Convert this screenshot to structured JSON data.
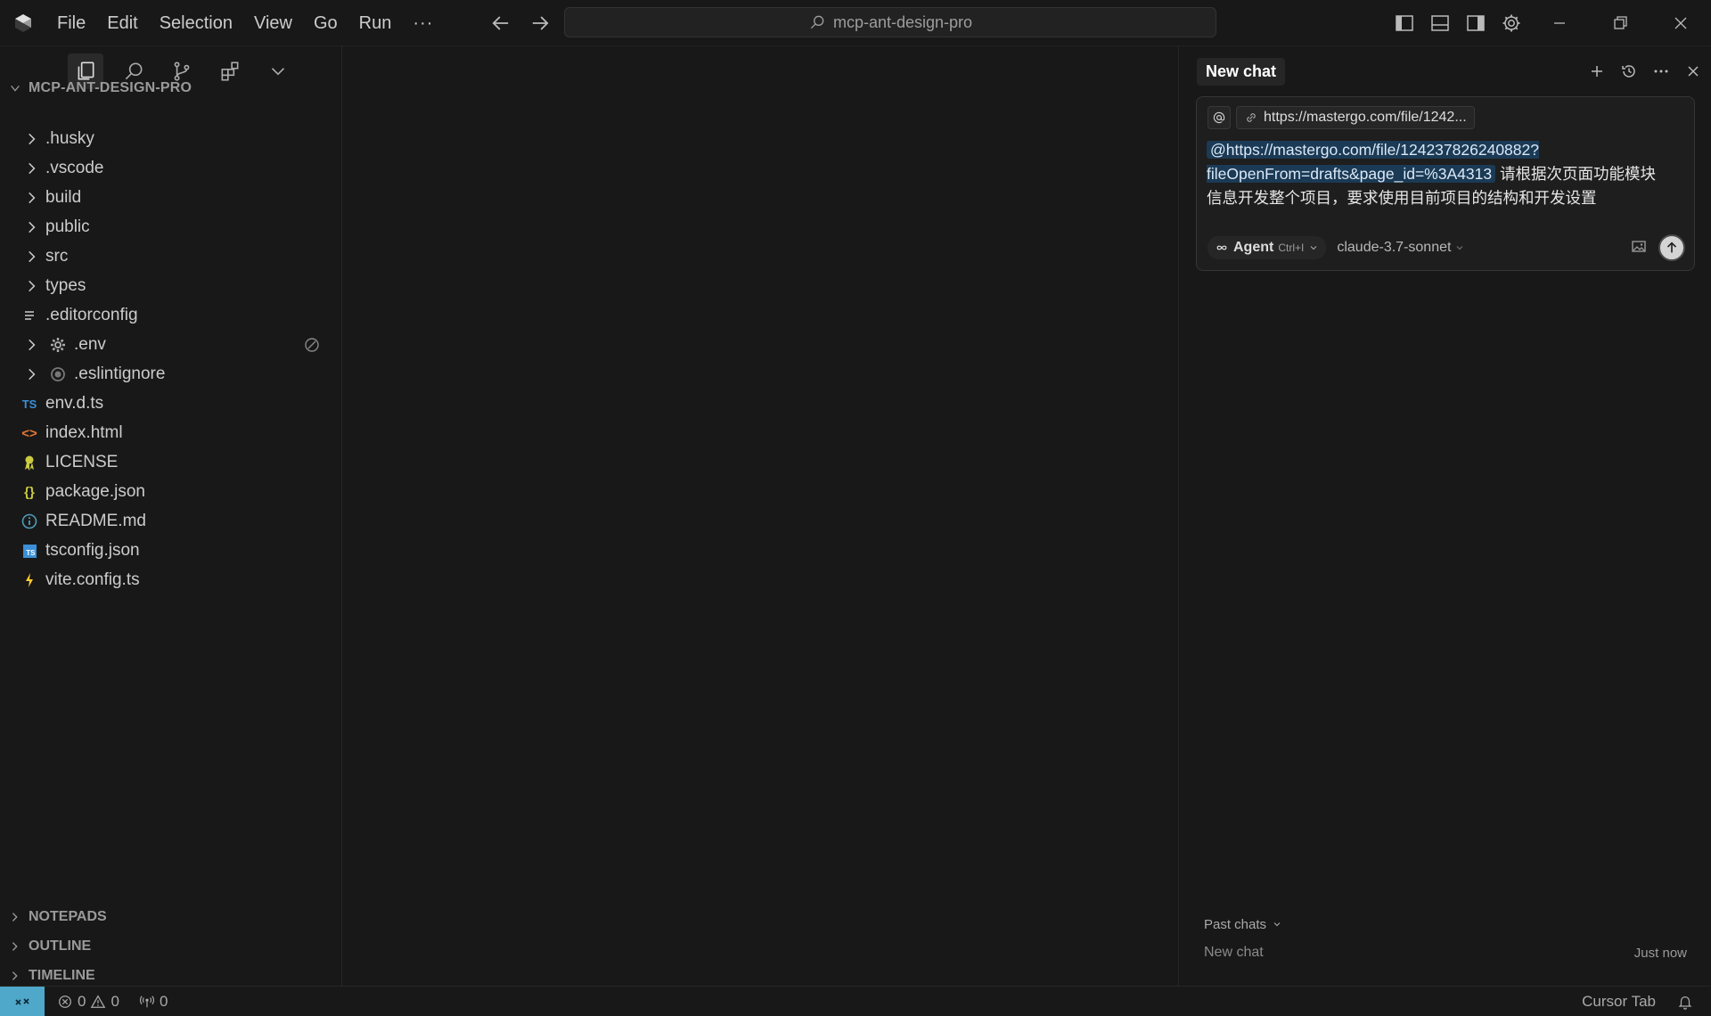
{
  "titlebar": {
    "menu": [
      "File",
      "Edit",
      "Selection",
      "View",
      "Go",
      "Run"
    ],
    "more": "···",
    "search_text": "mcp-ant-design-pro"
  },
  "sidebar": {
    "root_label": "MCP-ANT-DESIGN-PRO",
    "items": [
      {
        "label": ".husky",
        "kind": "folder"
      },
      {
        "label": ".vscode",
        "kind": "folder"
      },
      {
        "label": "build",
        "kind": "folder"
      },
      {
        "label": "public",
        "kind": "folder"
      },
      {
        "label": "src",
        "kind": "folder"
      },
      {
        "label": "types",
        "kind": "folder"
      },
      {
        "label": ".editorconfig",
        "kind": "file",
        "icon": "lines-icon"
      },
      {
        "label": ".env",
        "kind": "nested",
        "icon": "gear-icon"
      },
      {
        "label": ".eslintignore",
        "kind": "nested",
        "icon": "circle-icon"
      },
      {
        "label": "env.d.ts",
        "kind": "file",
        "icon": "ts-icon",
        "icon_text": "TS"
      },
      {
        "label": "index.html",
        "kind": "file",
        "icon": "html-icon",
        "icon_text": "<>"
      },
      {
        "label": "LICENSE",
        "kind": "file",
        "icon": "license-icon"
      },
      {
        "label": "package.json",
        "kind": "file",
        "icon": "json-icon",
        "icon_text": "{}"
      },
      {
        "label": "README.md",
        "kind": "file",
        "icon": "info-icon"
      },
      {
        "label": "tsconfig.json",
        "kind": "file",
        "icon": "tsconfig-icon",
        "icon_text": "TS"
      },
      {
        "label": "vite.config.ts",
        "kind": "file",
        "icon": "vite-icon"
      }
    ],
    "bottom_sections": [
      "NOTEPADS",
      "OUTLINE",
      "TIMELINE"
    ]
  },
  "chat": {
    "tab_label": "New chat",
    "context_pill": "https://mastergo.com/file/1242...",
    "prompt_mention_line1": "@https://mastergo.com/file/124237826240882?",
    "prompt_mention_line2": "fileOpenFrom=drafts&page_id=%3A4313",
    "prompt_text_line1": "请根据次页面功能模块",
    "prompt_text_line2": "信息开发整个项目，要求使用目前项目的结构和开发设置",
    "agent_label": "Agent",
    "agent_shortcut": "Ctrl+I",
    "model": "claude-3.7-sonnet",
    "past_chats_label": "Past chats",
    "past_chats": [
      {
        "title": "New chat",
        "time": "Just now"
      }
    ]
  },
  "statusbar": {
    "errors": "0",
    "warnings": "0",
    "ports": "0",
    "cursor_tab": "Cursor Tab"
  },
  "colors": {
    "background": "#181818",
    "remote_accent": "#4fa7c9",
    "mention_bg": "#1b3a55",
    "ts_blue": "#3b8fd6",
    "html_orange": "#e37933",
    "json_yellow": "#cbcb41"
  }
}
